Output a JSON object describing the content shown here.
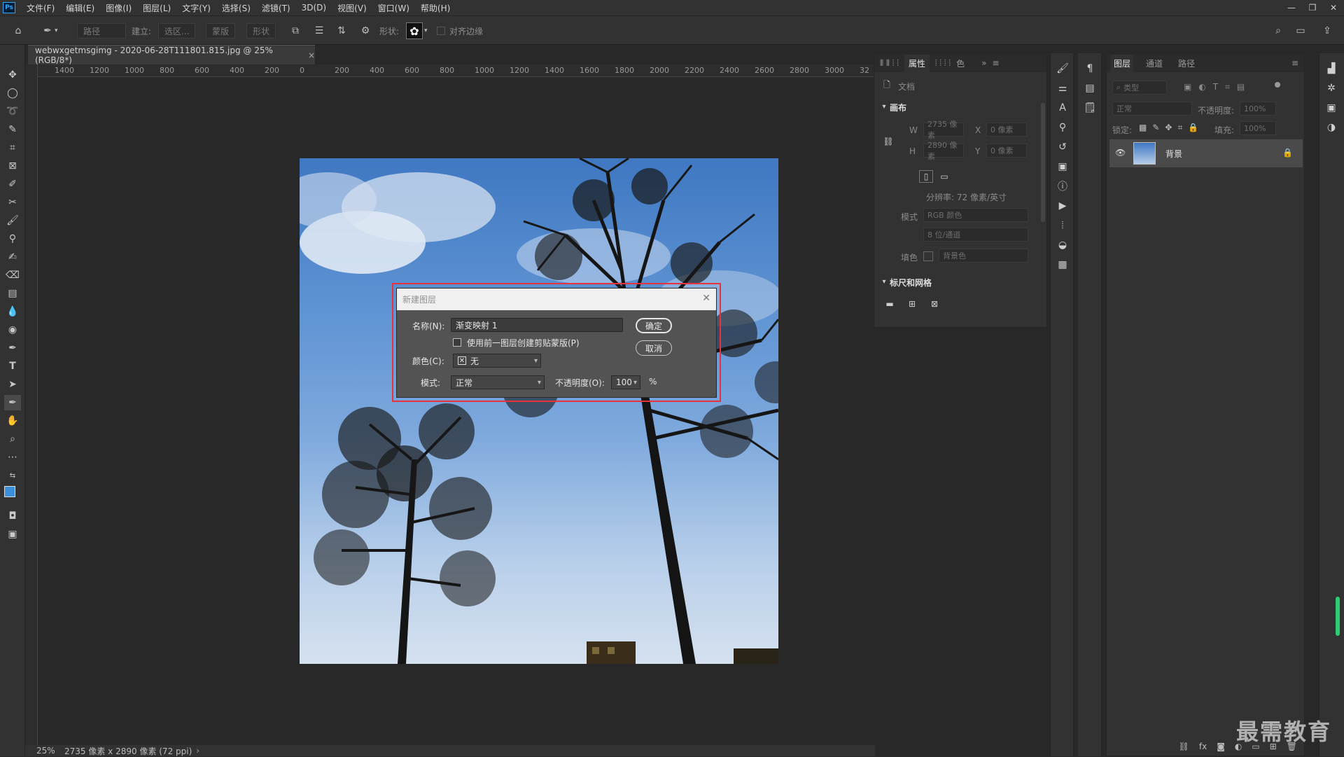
{
  "menubar": {
    "logo": "Ps",
    "items": [
      "文件(F)",
      "编辑(E)",
      "图像(I)",
      "图层(L)",
      "文字(Y)",
      "选择(S)",
      "滤镜(T)",
      "3D(D)",
      "视图(V)",
      "窗口(W)",
      "帮助(H)"
    ]
  },
  "options": {
    "path_mode": "路径",
    "make_label": "建立:",
    "selection_btn": "选区...",
    "mask_btn": "蒙版",
    "shape_btn": "形状",
    "shape_label": "形状:",
    "align_edges": "对齐边缘"
  },
  "document": {
    "tab_title": "webwxgetmsgimg - 2020-06-28T111801.815.jpg @ 25%(RGB/8*)",
    "zoom": "25%",
    "status": "2735 像素 x 2890 像素 (72 ppi)"
  },
  "ruler": {
    "h_labels": [
      "1400",
      "1200",
      "1000",
      "800",
      "600",
      "400",
      "200",
      "0",
      "200",
      "400",
      "600",
      "800",
      "1000",
      "1200",
      "1400",
      "1600",
      "1800",
      "2000",
      "2200",
      "2400",
      "2600",
      "2800",
      "3000",
      "32"
    ]
  },
  "dialog": {
    "title": "新建图层",
    "name_label": "名称(N):",
    "name_value": "渐变映射 1",
    "clip_label": "使用前一图层创建剪贴蒙版(P)",
    "color_label": "颜色(C):",
    "color_value": "无",
    "mode_label": "模式:",
    "mode_value": "正常",
    "opacity_label": "不透明度(O):",
    "opacity_value": "100",
    "percent": "%",
    "ok": "确定",
    "cancel": "取消"
  },
  "properties": {
    "tab_active": "属性",
    "tab_other": "色",
    "doc_label": "文档",
    "canvas_section": "画布",
    "w_label": "W",
    "w_value": "2735 像素",
    "h_label": "H",
    "h_value": "2890 像素",
    "x_label": "X",
    "x_value": "0 像素",
    "y_label": "Y",
    "y_value": "0 像素",
    "resolution": "分辨率: 72 像素/英寸",
    "mode_label": "模式",
    "mode_value": "RGB 颜色",
    "depth_value": "8 位/通道",
    "fill_label": "填色",
    "fill_value": "背景色",
    "rulers_section": "标尺和网格"
  },
  "layers": {
    "tabs": [
      "图层",
      "通道",
      "路径"
    ],
    "kind_label": "类型",
    "blend_mode": "正常",
    "opacity_label": "不透明度:",
    "opacity_value": "100%",
    "lock_label": "锁定:",
    "fill_label": "填充:",
    "fill_value": "100%",
    "layer_name": "背景"
  },
  "watermark": "最需教育"
}
